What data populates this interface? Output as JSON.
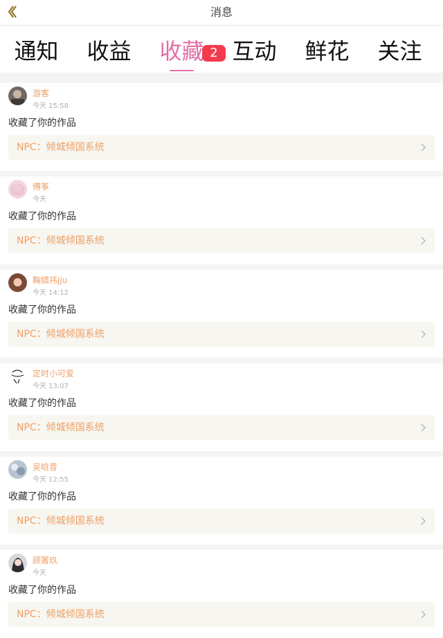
{
  "header": {
    "title": "消息"
  },
  "tabs": [
    {
      "label": "通知"
    },
    {
      "label": "收益"
    },
    {
      "label": "收藏"
    },
    {
      "label": "互动"
    },
    {
      "label": "鲜花"
    },
    {
      "label": "关注"
    }
  ],
  "active_tab_badge": "2",
  "colors": {
    "accent": "#e36fa6",
    "name": "#f0a066",
    "badge": "#f23c4d"
  },
  "icons": {
    "back": "back-chevron-icon",
    "row_chevron": "chevron-right-icon"
  },
  "items": [
    {
      "name": "游客",
      "time": "今天 15:58",
      "message": "收藏了你的作品",
      "work": "NPC：倾城倾国系统"
    },
    {
      "name": "傅筝",
      "time": "今天",
      "message": "收藏了你的作品",
      "work": "NPC：倾城倾国系统"
    },
    {
      "name": "鞠婧祎jju",
      "time": "今天 14:12",
      "message": "收藏了你的作品",
      "work": "NPC：倾城倾国系统"
    },
    {
      "name": "定时小可爱",
      "time": "今天 13:07",
      "message": "收藏了你的作品",
      "work": "NPC：倾城倾国系统"
    },
    {
      "name": "吴晗昔",
      "time": "今天 12:55",
      "message": "收藏了你的作品",
      "work": "NPC：倾城倾国系统"
    },
    {
      "name": "顾箐玖",
      "time": "今天",
      "message": "收藏了你的作品",
      "work": "NPC：倾城倾国系统"
    }
  ]
}
